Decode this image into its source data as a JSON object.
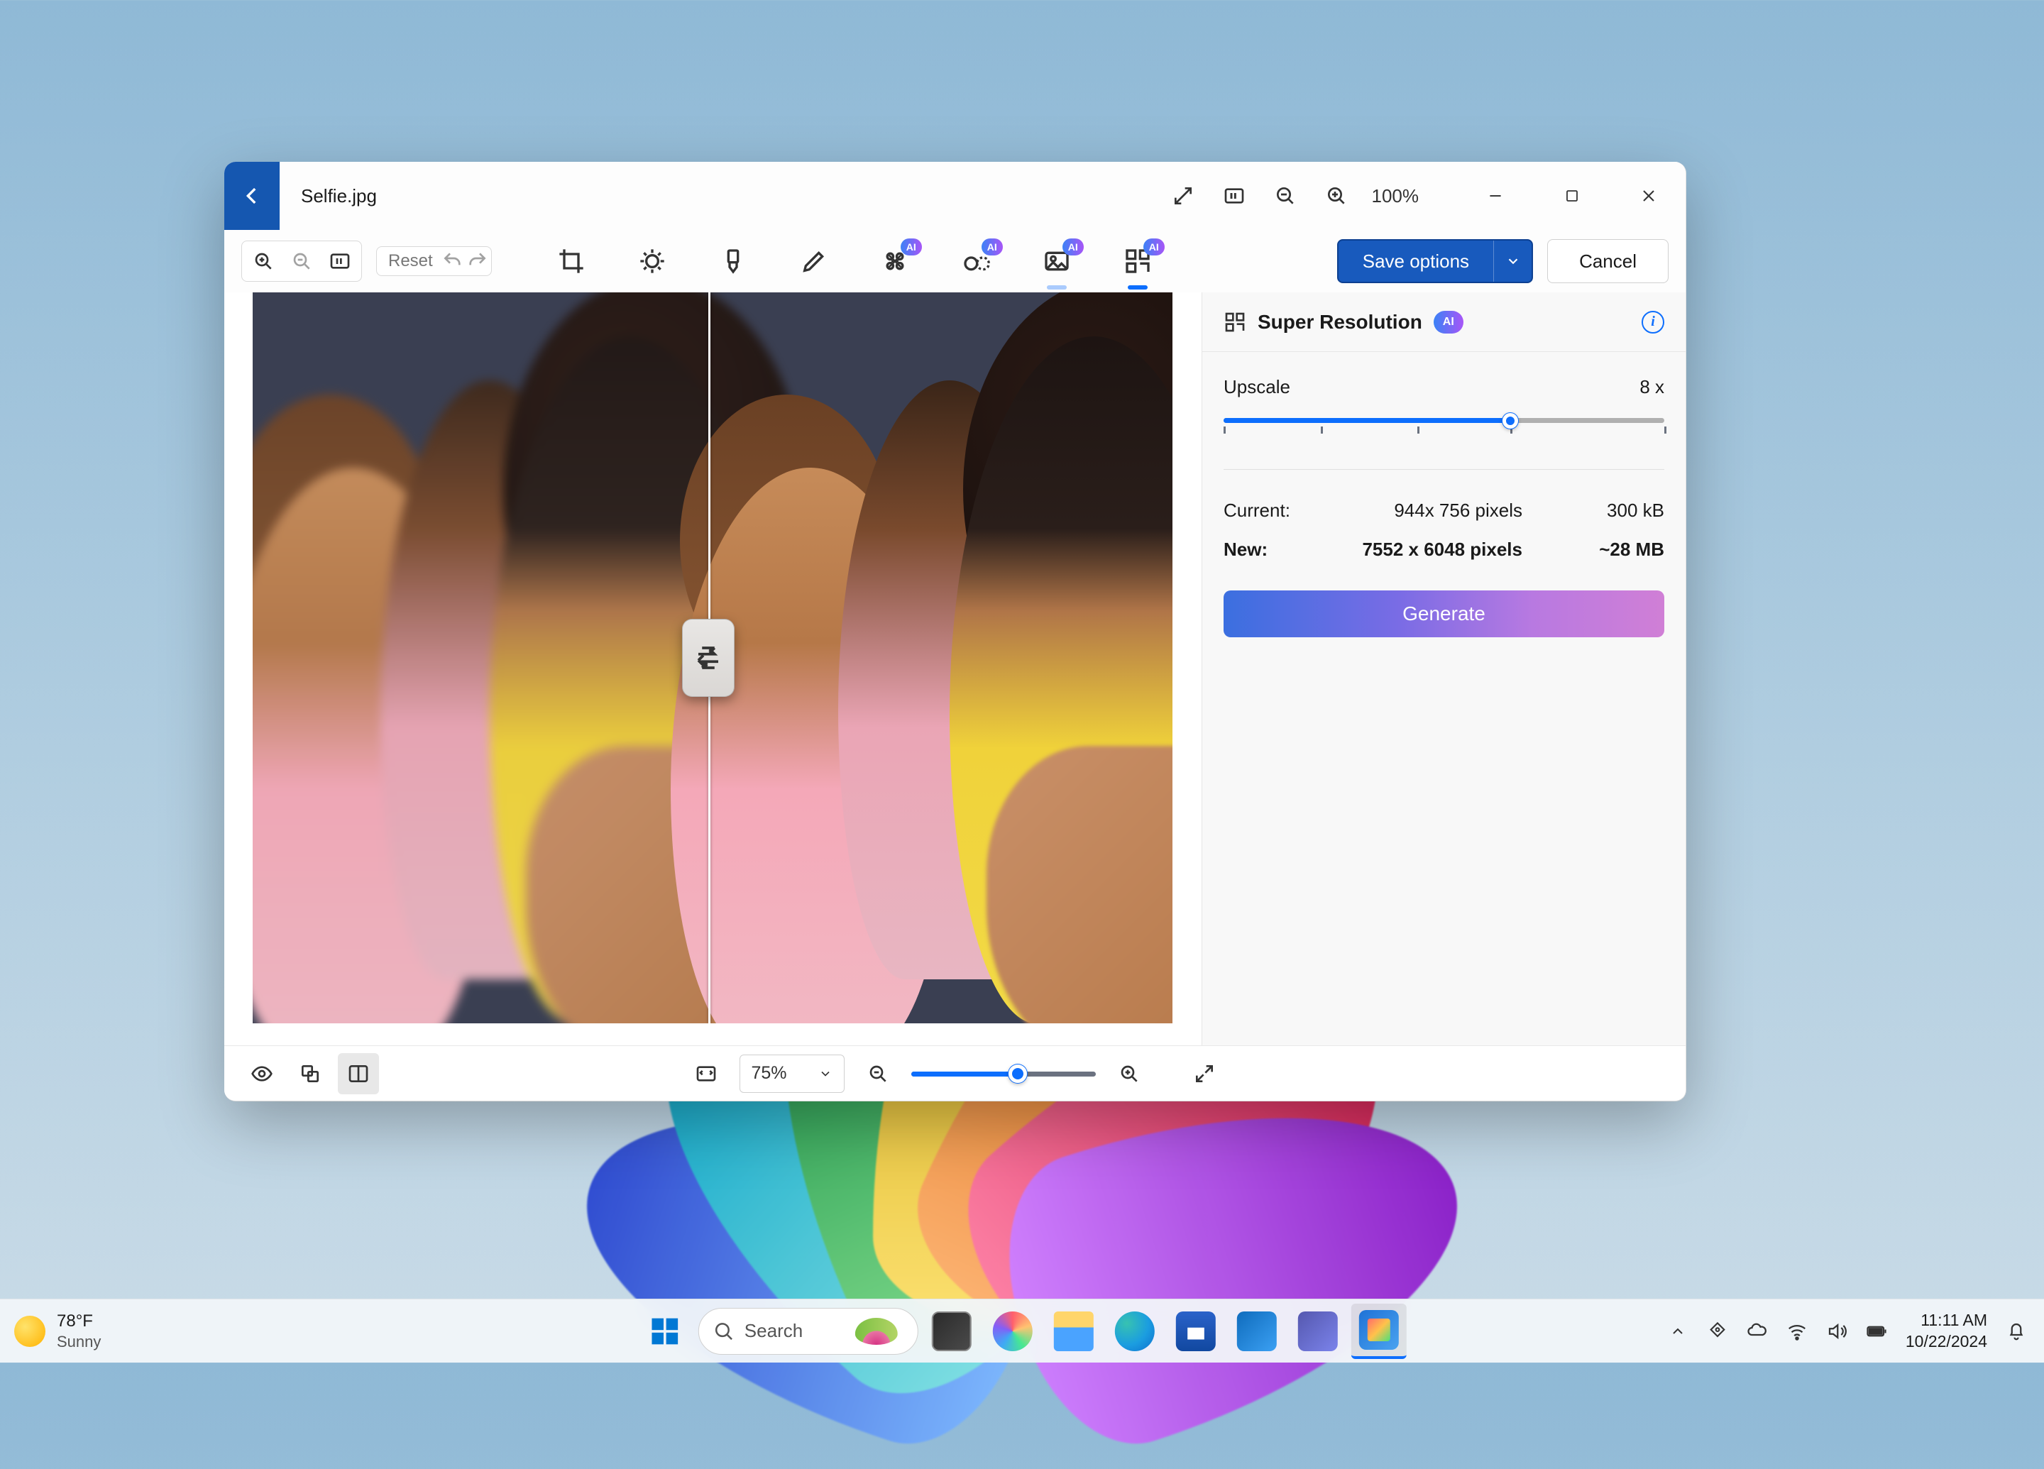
{
  "window": {
    "filename": "Selfie.jpg",
    "zoom_percent": "100%",
    "minimize": "Minimize",
    "maximize": "Maximize",
    "close": "Close"
  },
  "ribbon": {
    "reset_label": "Reset",
    "save_label": "Save options",
    "cancel_label": "Cancel",
    "ai_badge": "AI"
  },
  "panel": {
    "title": "Super Resolution",
    "ai_badge": "AI",
    "upscale_label": "Upscale",
    "upscale_value": "8 x",
    "current_label": "Current:",
    "current_dims": "944x 756 pixels",
    "current_size": "300 kB",
    "new_label": "New:",
    "new_dims": "7552 x 6048 pixels",
    "new_size": "~28 MB",
    "generate_label": "Generate"
  },
  "footer": {
    "zoom_select": "75%"
  },
  "taskbar": {
    "temp": "78°F",
    "condition": "Sunny",
    "search_placeholder": "Search",
    "time": "11:11 AM",
    "date": "10/22/2024"
  }
}
